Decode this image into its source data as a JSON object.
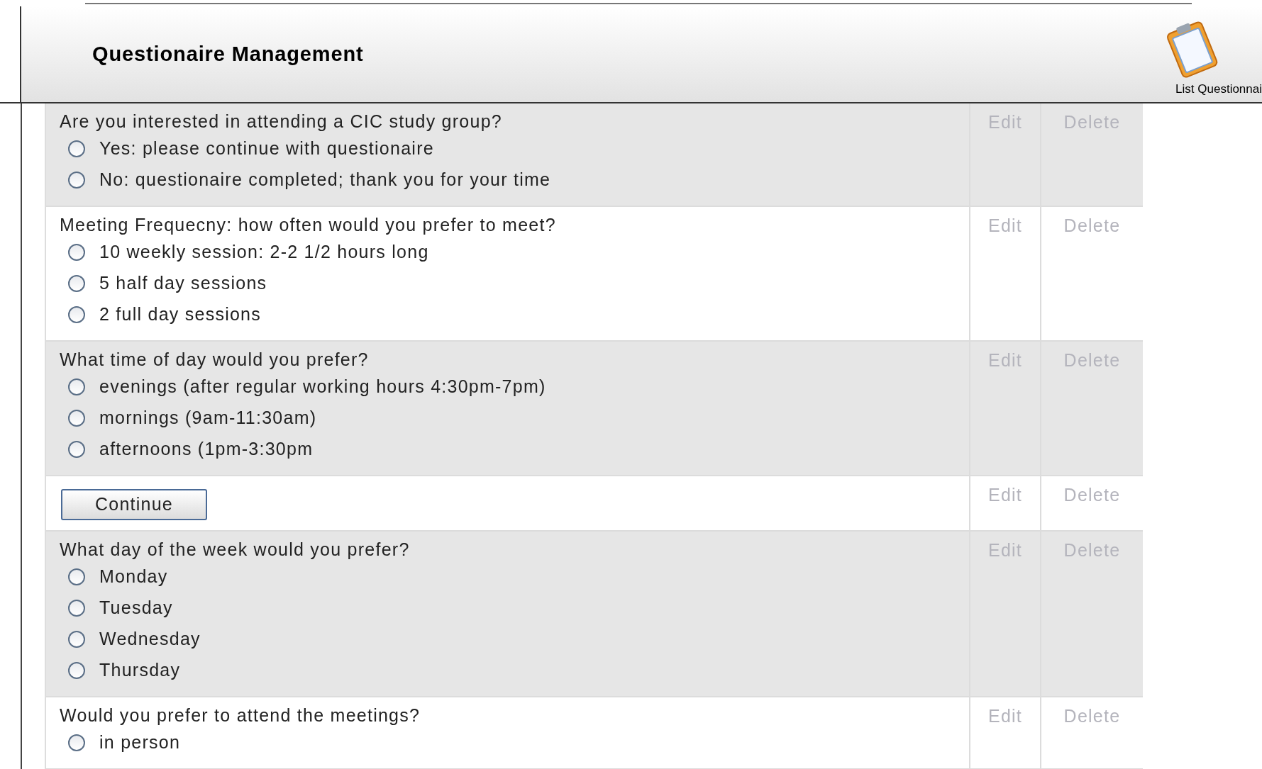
{
  "header": {
    "title": "Questionaire Management",
    "link_label": "List Questionnai"
  },
  "rows": [
    {
      "kind": "question",
      "text": "Are you interested in attending a CIC study group?",
      "options": [
        {
          "label": "Yes: please continue with questionaire",
          "selected": false
        },
        {
          "label": "No: questionaire completed; thank you for your time",
          "selected": false
        }
      ],
      "actions": [
        {
          "label": "Edit",
          "disabled": true
        },
        {
          "label": "Delete",
          "disabled": true
        }
      ]
    },
    {
      "kind": "question",
      "text": "Meeting Frequecny: how often would you prefer to meet?",
      "options": [
        {
          "label": "10 weekly session: 2-2 1/2 hours long",
          "selected": false
        },
        {
          "label": "5 half day sessions",
          "selected": false
        },
        {
          "label": "2 full day sessions",
          "selected": false
        }
      ],
      "actions": [
        {
          "label": "Edit",
          "disabled": true
        },
        {
          "label": "Delete",
          "disabled": true
        }
      ]
    },
    {
      "kind": "question",
      "text": "What time of day would you prefer?",
      "options": [
        {
          "label": "evenings (after regular working hours 4:30pm-7pm)",
          "selected": false
        },
        {
          "label": "mornings (9am-11:30am)",
          "selected": false
        },
        {
          "label": "afternoons (1pm-3:30pm",
          "selected": false
        }
      ],
      "actions": [
        {
          "label": "Edit",
          "disabled": true
        },
        {
          "label": "Delete",
          "disabled": true
        }
      ]
    },
    {
      "kind": "button",
      "label": "Continue",
      "actions": [
        {
          "label": "Edit",
          "disabled": true
        },
        {
          "label": "Delete",
          "disabled": true
        }
      ]
    },
    {
      "kind": "question",
      "text": "What day of the week would you prefer?",
      "options": [
        {
          "label": "Monday",
          "selected": false
        },
        {
          "label": "Tuesday",
          "selected": false
        },
        {
          "label": "Wednesday",
          "selected": false
        },
        {
          "label": "Thursday",
          "selected": false
        }
      ],
      "actions": [
        {
          "label": "Edit",
          "disabled": true
        },
        {
          "label": "Delete",
          "disabled": true
        }
      ]
    },
    {
      "kind": "question",
      "text": "Would you prefer to attend the meetings?",
      "options": [
        {
          "label": "in person",
          "selected": false
        }
      ],
      "actions": [
        {
          "label": "Edit",
          "disabled": true
        },
        {
          "label": "Delete",
          "disabled": true
        }
      ]
    }
  ]
}
